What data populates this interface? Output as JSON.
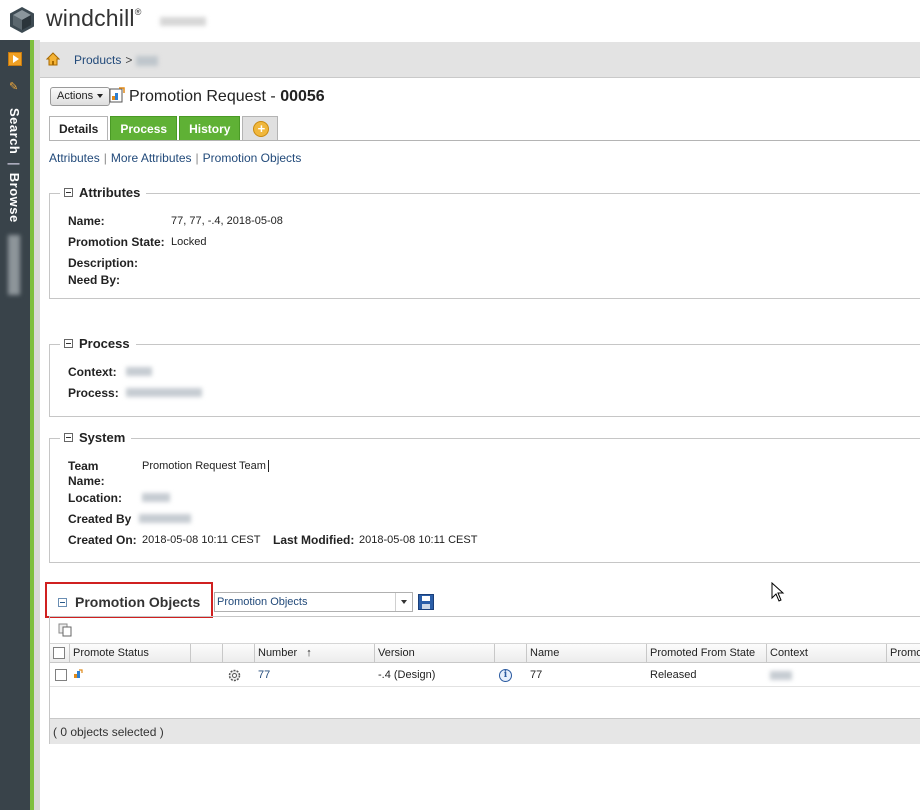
{
  "app": {
    "name": "windchill",
    "tm": "®"
  },
  "leftnav": {
    "vertical_label_1": "Search",
    "vertical_label_2": "Browse",
    "separator": "|"
  },
  "breadcrumb": {
    "products": "Products",
    "sep": ">"
  },
  "header": {
    "actions_label": "Actions",
    "title_prefix": "Promotion Request - ",
    "number": "00056"
  },
  "tabs": [
    {
      "label": "Details",
      "state": "active"
    },
    {
      "label": "Process",
      "state": "green"
    },
    {
      "label": "History",
      "state": "green"
    }
  ],
  "links": [
    "Attributes",
    "More Attributes",
    "Promotion Objects"
  ],
  "attributes": {
    "heading": "Attributes",
    "name_label": "Name:",
    "name_value": "77, 77, -.4, 2018-05-08",
    "state_label": "Promotion State:",
    "state_value": "Locked",
    "description_label": "Description:",
    "needby_label": "Need By:"
  },
  "process": {
    "heading": "Process",
    "context_label": "Context:",
    "process_label": "Process:"
  },
  "system": {
    "heading": "System",
    "team_label_1": "Team",
    "team_label_2": "Name:",
    "team_value": "Promotion Request Team",
    "location_label": "Location:",
    "created_by_label": "Created By",
    "created_on_label": "Created On:",
    "created_on_value": "2018-05-08 10:11 CEST",
    "modified_label": "Last Modified:",
    "modified_value": "2018-05-08 10:11 CEST"
  },
  "promotion_objects": {
    "title": "Promotion Objects",
    "view_select": "Promotion Objects",
    "columns": [
      "Promote Status",
      "",
      "Number",
      "Version",
      "",
      "Name",
      "Promoted From State",
      "Context",
      "Promot"
    ],
    "sort_indicator": "↑",
    "rows": [
      {
        "number": "77",
        "version": "-.4 (Design)",
        "name": "77",
        "from_state": "Released"
      }
    ],
    "footer": "( 0 objects selected )"
  }
}
